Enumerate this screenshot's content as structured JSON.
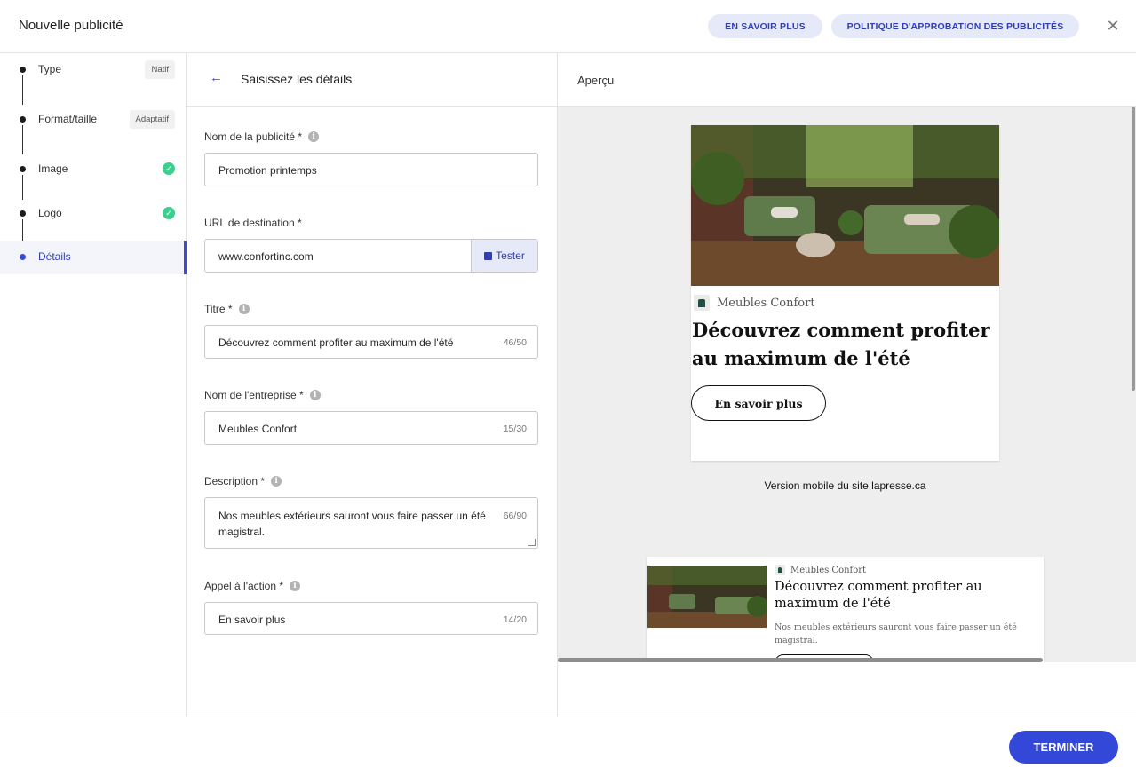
{
  "header": {
    "title": "Nouvelle publicité",
    "learn_more": "EN SAVOIR PLUS",
    "policy": "POLITIQUE D'APPROBATION DES PUBLICITÉS",
    "close_icon": "close-icon"
  },
  "steps": [
    {
      "label": "Type",
      "badge": "Natif",
      "status": "pending"
    },
    {
      "label": "Format/taille",
      "badge": "Adaptatif",
      "status": "pending"
    },
    {
      "label": "Image",
      "status": "complete"
    },
    {
      "label": "Logo",
      "status": "complete"
    },
    {
      "label": "Détails",
      "status": "active"
    }
  ],
  "form": {
    "title": "Saisissez les détails",
    "fields": {
      "ad_name": {
        "label": "Nom de la publicité *",
        "value": "Promotion printemps"
      },
      "url": {
        "label": "URL de destination *",
        "value": "www.confortinc.com",
        "button": "Tester"
      },
      "title": {
        "label": "Titre *",
        "value": "Découvrez comment profiter au maximum de l'été",
        "count": "46/50"
      },
      "company": {
        "label": "Nom de l'entreprise *",
        "value": "Meubles Confort",
        "count": "15/30"
      },
      "description": {
        "label": "Description *",
        "value": "Nos meubles extérieurs sauront vous faire passer un été magistral.",
        "count": "66/90"
      },
      "cta": {
        "label": "Appel à l'action *",
        "value": "En savoir plus",
        "count": "14/20"
      }
    }
  },
  "preview": {
    "title": "Aperçu",
    "card": {
      "brand": "Meubles Confort",
      "headline": "Découvrez comment profiter au maximum de l'été",
      "cta": "En savoir plus"
    },
    "caption": "Version mobile du site lapresse.ca",
    "card2": {
      "brand": "Meubles Confort",
      "headline": "Découvrez comment profiter au maximum de l'été",
      "description": "Nos meubles extérieurs sauront vous faire passer un été magistral."
    }
  },
  "footer": {
    "finish": "TERMINER"
  },
  "colors": {
    "accent": "#3347d9",
    "pill_bg": "#e6eaf8",
    "success": "#3ccf8e"
  }
}
